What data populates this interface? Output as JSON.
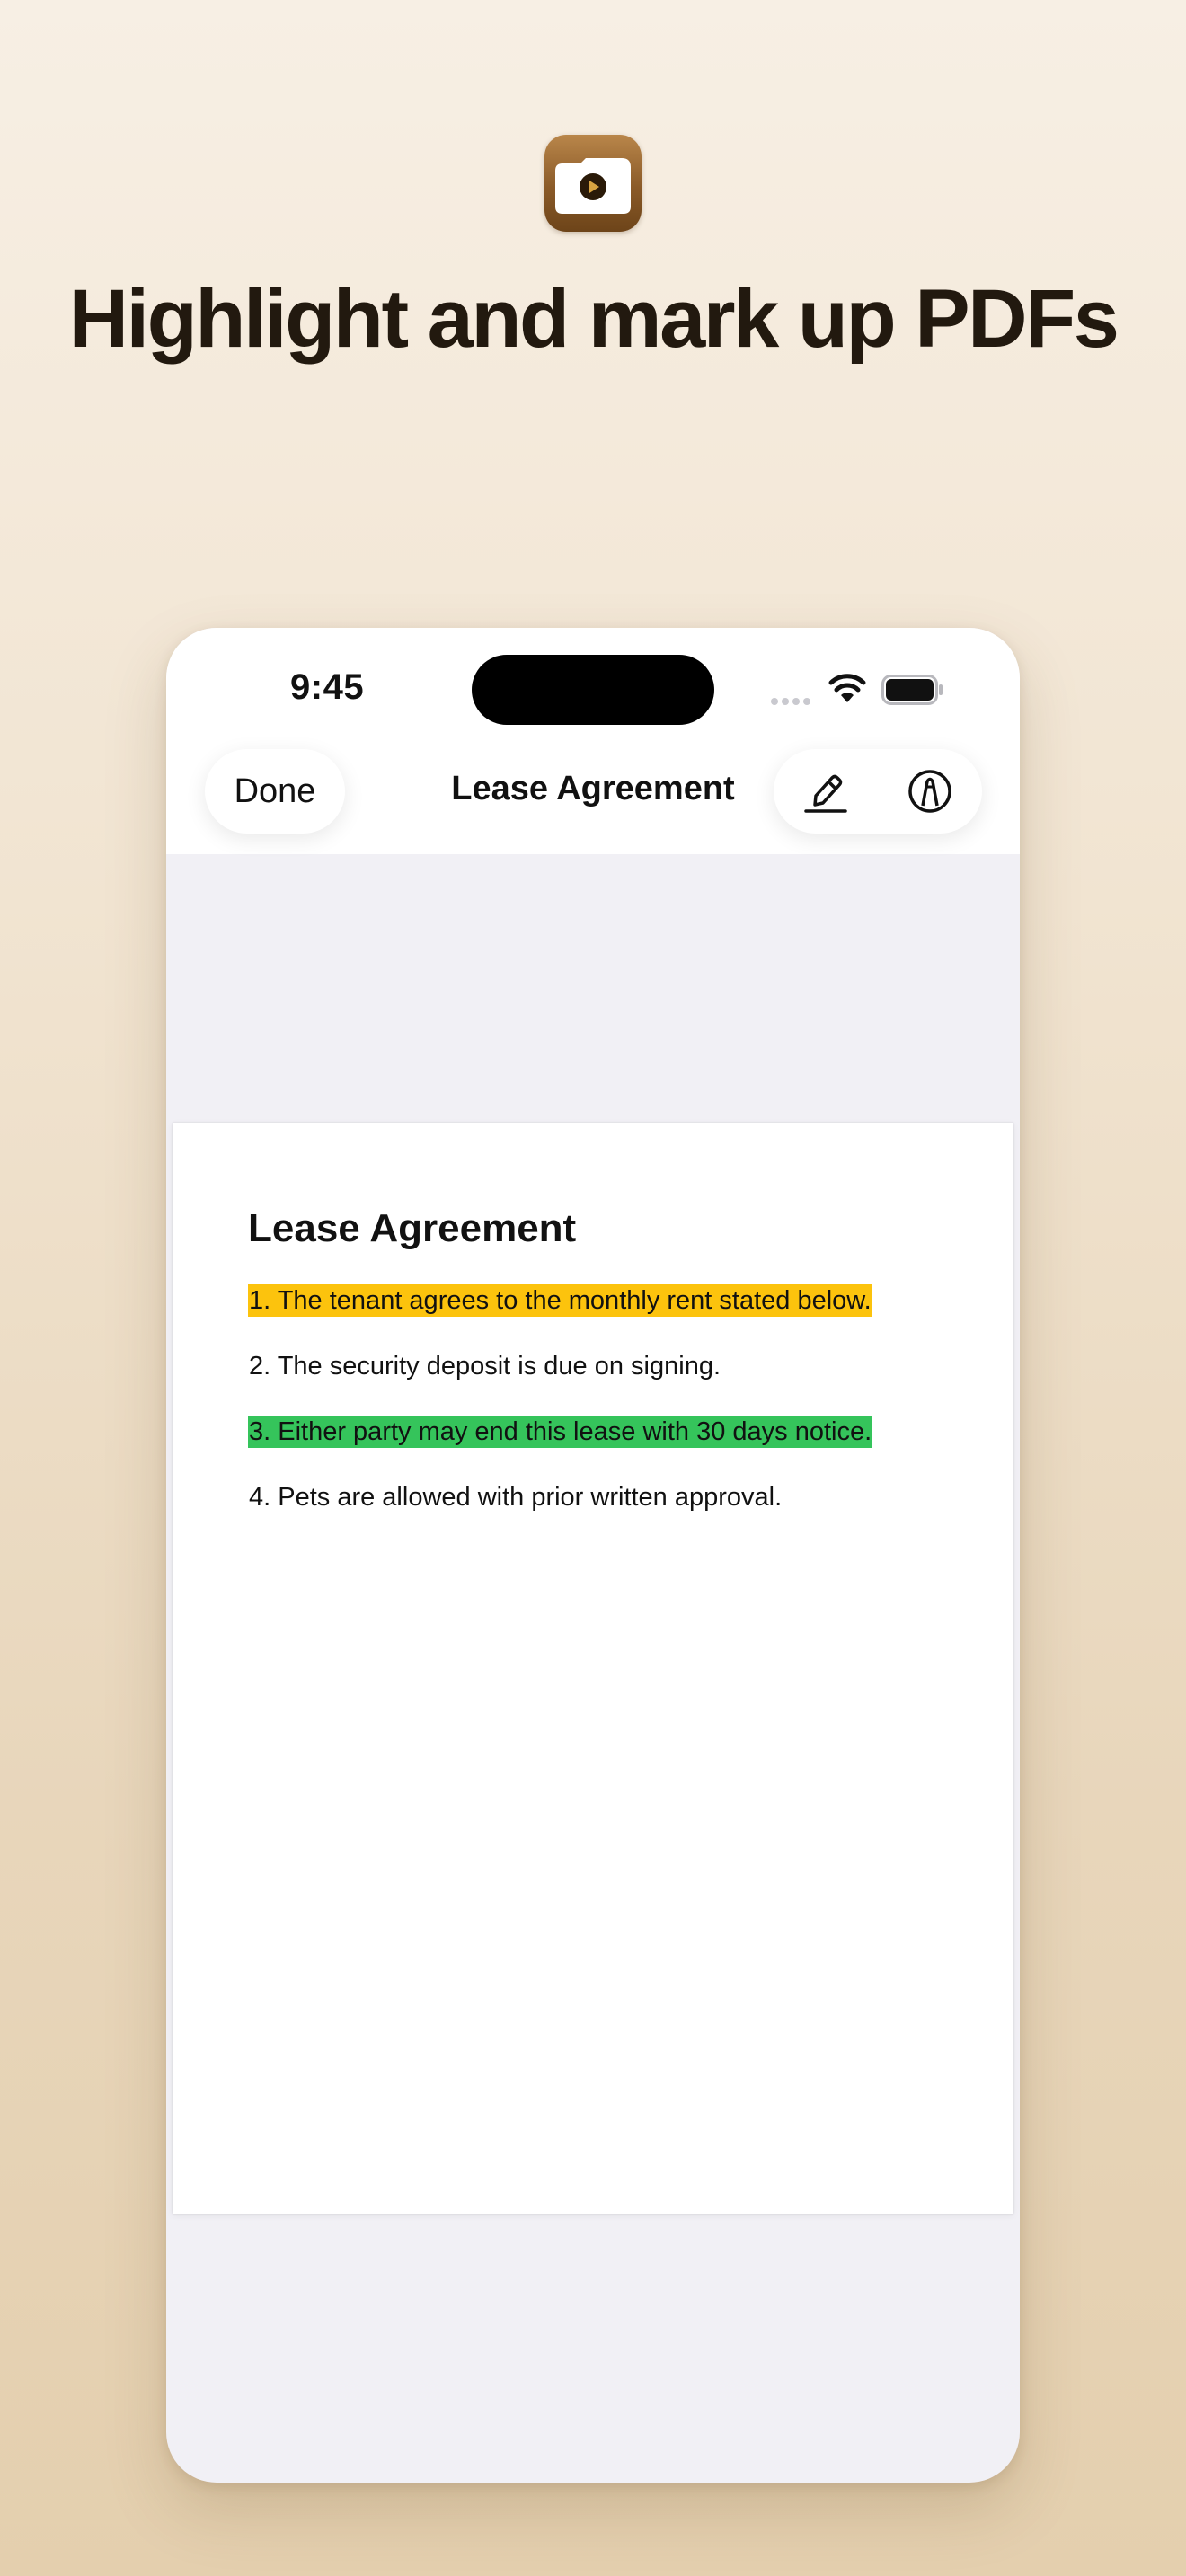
{
  "headline": "Highlight and mark up PDFs",
  "app_icon": {
    "icon": "folder-play-icon",
    "colors": {
      "tile_top": "#b9864a",
      "tile_bottom": "#6d4419",
      "folder": "#ffffff",
      "play": "#2a1a08"
    }
  },
  "status_bar": {
    "time": "9:45",
    "icons": [
      "signal-dots-icon",
      "wifi-icon",
      "battery-icon"
    ]
  },
  "nav_bar": {
    "done_label": "Done",
    "title": "Lease Agreement",
    "tools": [
      "highlighter-icon",
      "markup-pen-icon"
    ]
  },
  "document": {
    "title": "Lease Agreement",
    "lines": [
      {
        "text": "1. The tenant agrees to the monthly rent stated below.",
        "highlight": "#fcc30d"
      },
      {
        "text": "2. The security deposit is due on signing.",
        "highlight": ""
      },
      {
        "text": "3. Either party may end this lease with 30 days notice.",
        "highlight": "#35c45b"
      },
      {
        "text": "4. Pets are allowed with prior written approval.",
        "highlight": ""
      }
    ]
  },
  "colors": {
    "background_top": "#f7efe4",
    "background_bottom": "#e4cfae",
    "headline": "#22190f",
    "document_area": "#f1f0f5",
    "highlight_yellow": "#fcc30d",
    "highlight_green": "#35c45b"
  }
}
